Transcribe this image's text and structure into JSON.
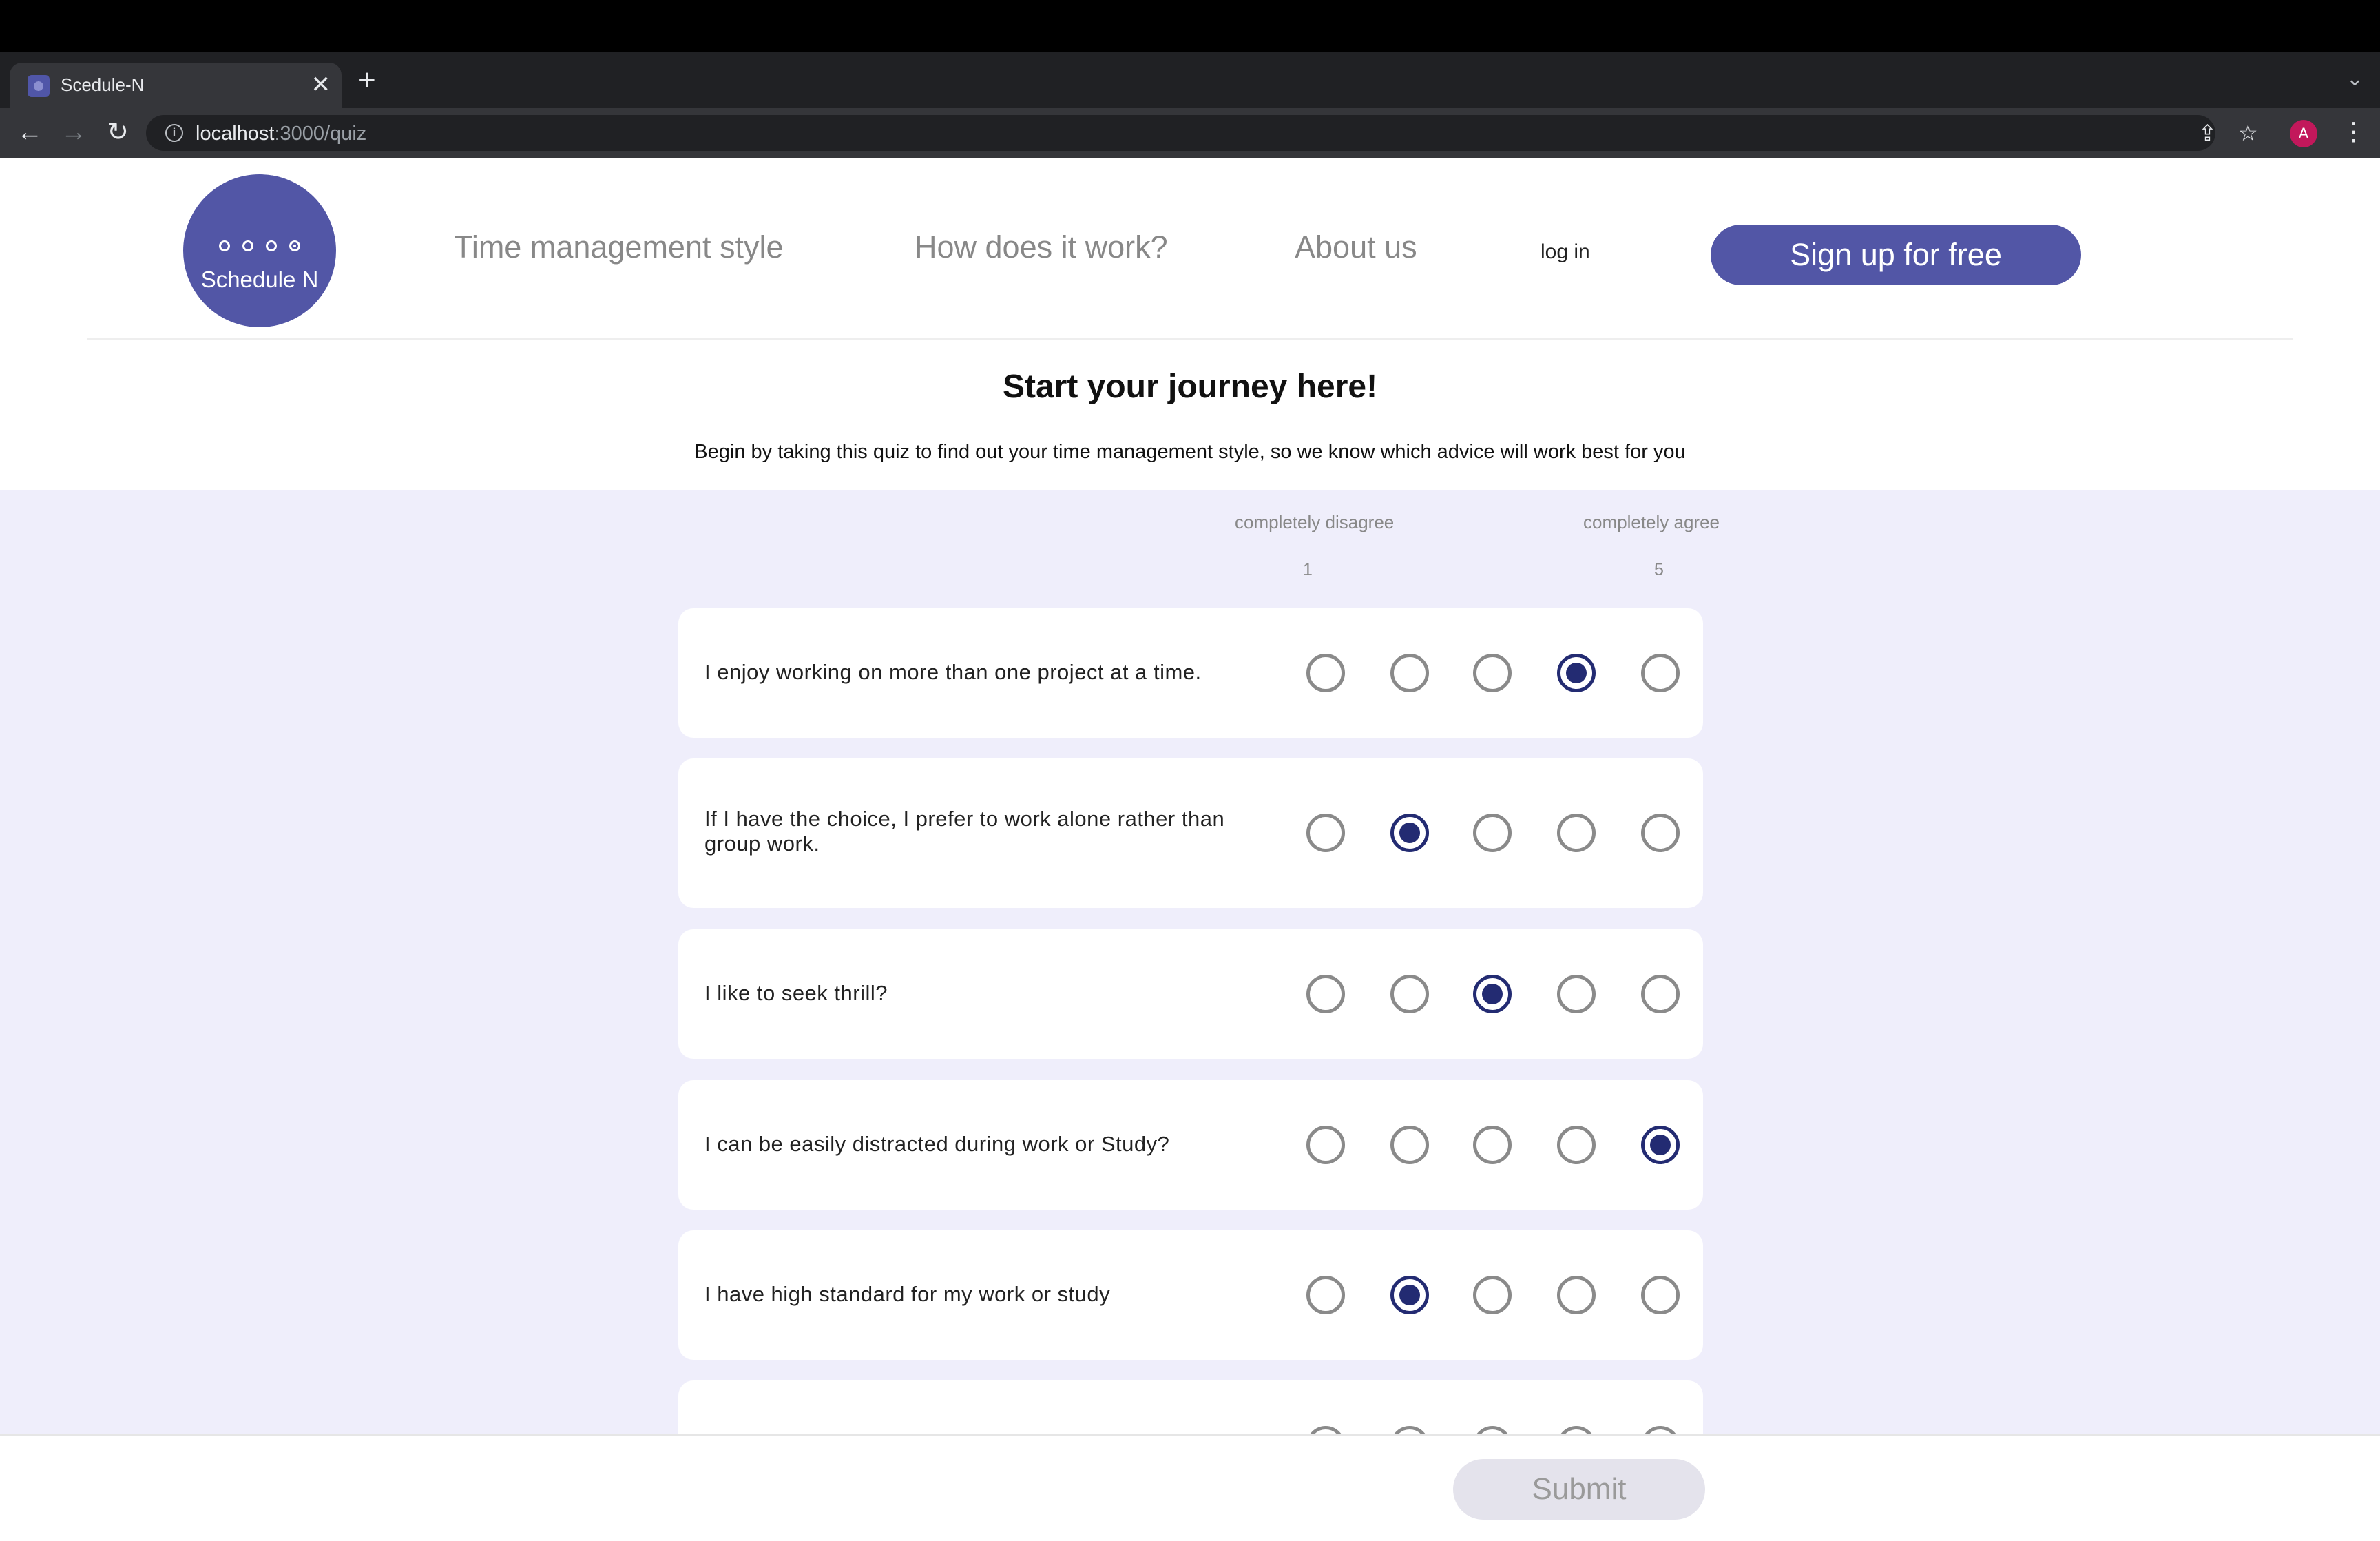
{
  "browser": {
    "tab_title": "Scedule-N",
    "tab_close": "✕",
    "new_tab": "+",
    "tab_menu": "⌄",
    "url_host": "localhost",
    "url_path": ":3000/quiz",
    "avatar_letter": "A",
    "back": "←",
    "forward": "→",
    "reload": "↻",
    "share": "⇪",
    "star": "☆",
    "kebab": "⋮",
    "info": "i"
  },
  "header": {
    "logo_text": "Schedule N",
    "nav": [
      "Time management style",
      "How does it work?",
      "About us"
    ],
    "login": "log in",
    "signup": "Sign up for free"
  },
  "intro": {
    "title": "Start your journey here!",
    "subtitle": "Begin by taking this quiz to find out your time management style, so we know which advice will work best for you"
  },
  "scale": {
    "left_label": "completely disagree",
    "right_label": "completely agree",
    "left_num": "1",
    "right_num": "5"
  },
  "questions": [
    {
      "text": "I enjoy working on more than one project at a time.",
      "selected": 4
    },
    {
      "text": "If I have the choice, I prefer to work alone rather than group work.",
      "selected": 2
    },
    {
      "text": "I like to seek thrill?",
      "selected": 3
    },
    {
      "text": "I can be easily distracted during work or Study?",
      "selected": 5
    },
    {
      "text": "I have high standard for my work or study",
      "selected": 2
    }
  ],
  "footer": {
    "submit": "Submit"
  }
}
